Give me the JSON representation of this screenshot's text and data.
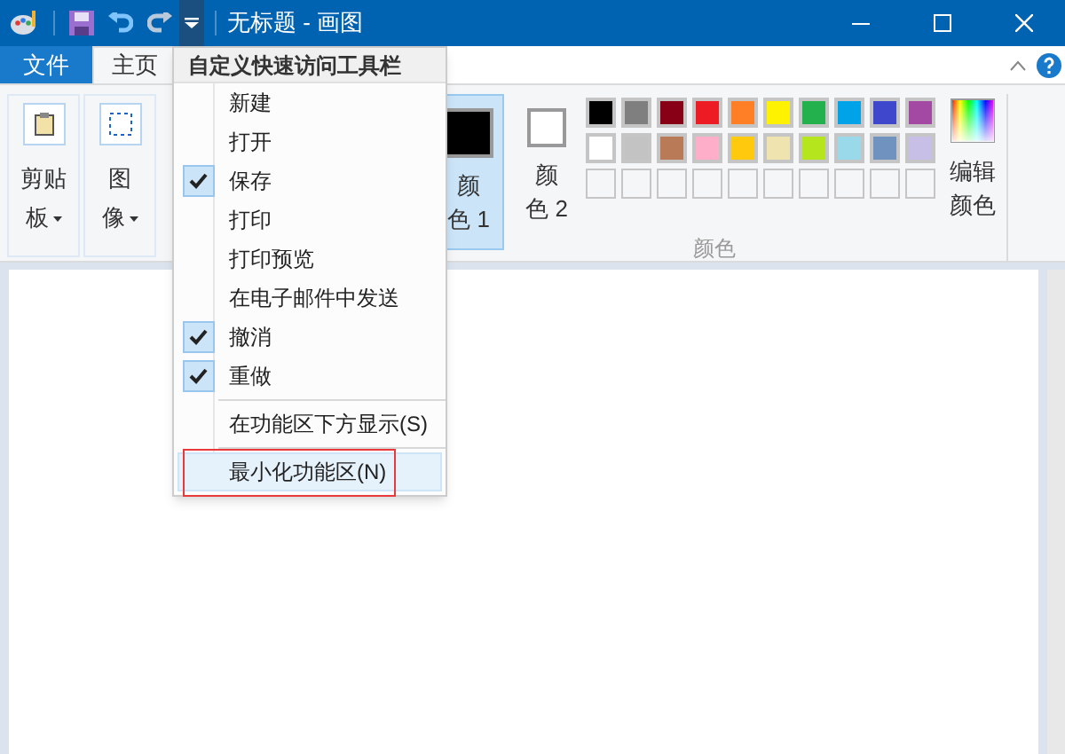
{
  "window": {
    "title": "无标题 - 画图"
  },
  "tabs": [
    {
      "label": "文件",
      "kind": "file",
      "selected": false
    },
    {
      "label": "主页",
      "kind": "tab",
      "selected": true
    }
  ],
  "ribbon": {
    "groups": [
      {
        "label_lines": [
          "剪贴",
          "板"
        ],
        "kind": "clipboard"
      },
      {
        "label_lines": [
          "图",
          "像"
        ],
        "kind": "image"
      }
    ],
    "color1": {
      "label_lines": [
        "颜",
        "色 1"
      ],
      "selected": true,
      "color": "#000000"
    },
    "color2": {
      "label_lines": [
        "颜",
        "色 2"
      ],
      "selected": false,
      "color": "#ffffff"
    },
    "palette": [
      [
        {
          "color": "#000000"
        },
        {
          "color": "#7f7f7f"
        },
        {
          "color": "#880015"
        },
        {
          "color": "#ed1c24"
        },
        {
          "color": "#ff7f27"
        },
        {
          "color": "#fff200"
        },
        {
          "color": "#22b14c"
        },
        {
          "color": "#00a2e8"
        },
        {
          "color": "#3f48cc"
        },
        {
          "color": "#a349a4"
        }
      ],
      [
        {
          "color": "#ffffff"
        },
        {
          "color": "#c3c3c3"
        },
        {
          "color": "#b97a57"
        },
        {
          "color": "#ffaec9"
        },
        {
          "color": "#ffc90e"
        },
        {
          "color": "#efe4b0"
        },
        {
          "color": "#b5e61d"
        },
        {
          "color": "#99d9ea"
        },
        {
          "color": "#7092be"
        },
        {
          "color": "#c8bfe7"
        }
      ],
      [
        {
          "kind": "empty"
        },
        {
          "kind": "empty"
        },
        {
          "kind": "empty"
        },
        {
          "kind": "empty"
        },
        {
          "kind": "empty"
        },
        {
          "kind": "empty"
        },
        {
          "kind": "empty"
        },
        {
          "kind": "empty"
        },
        {
          "kind": "empty"
        },
        {
          "kind": "empty"
        }
      ]
    ],
    "edit_colors": {
      "label_lines": [
        "编辑",
        "颜色"
      ]
    },
    "group_label": "颜色"
  },
  "menu": {
    "title": "自定义快速访问工具栏",
    "items": [
      {
        "label": "新建",
        "kind": "item",
        "checked": false,
        "selected": false
      },
      {
        "label": "打开",
        "kind": "item",
        "checked": false,
        "selected": false
      },
      {
        "label": "保存",
        "kind": "item",
        "checked": true,
        "selected": false
      },
      {
        "label": "打印",
        "kind": "item",
        "checked": false,
        "selected": false
      },
      {
        "label": "打印预览",
        "kind": "item",
        "checked": false,
        "selected": false
      },
      {
        "label": "在电子邮件中发送",
        "kind": "item",
        "checked": false,
        "selected": false
      },
      {
        "label": "撤消",
        "kind": "item",
        "checked": true,
        "selected": false
      },
      {
        "label": "重做",
        "kind": "item",
        "checked": true,
        "selected": false
      },
      {
        "kind": "separator"
      },
      {
        "label": "在功能区下方显示(S)",
        "kind": "item",
        "checked": false,
        "selected": false
      },
      {
        "kind": "separator"
      },
      {
        "label": "最小化功能区(N)",
        "kind": "item",
        "checked": false,
        "selected": true,
        "highlighted": true
      }
    ]
  }
}
